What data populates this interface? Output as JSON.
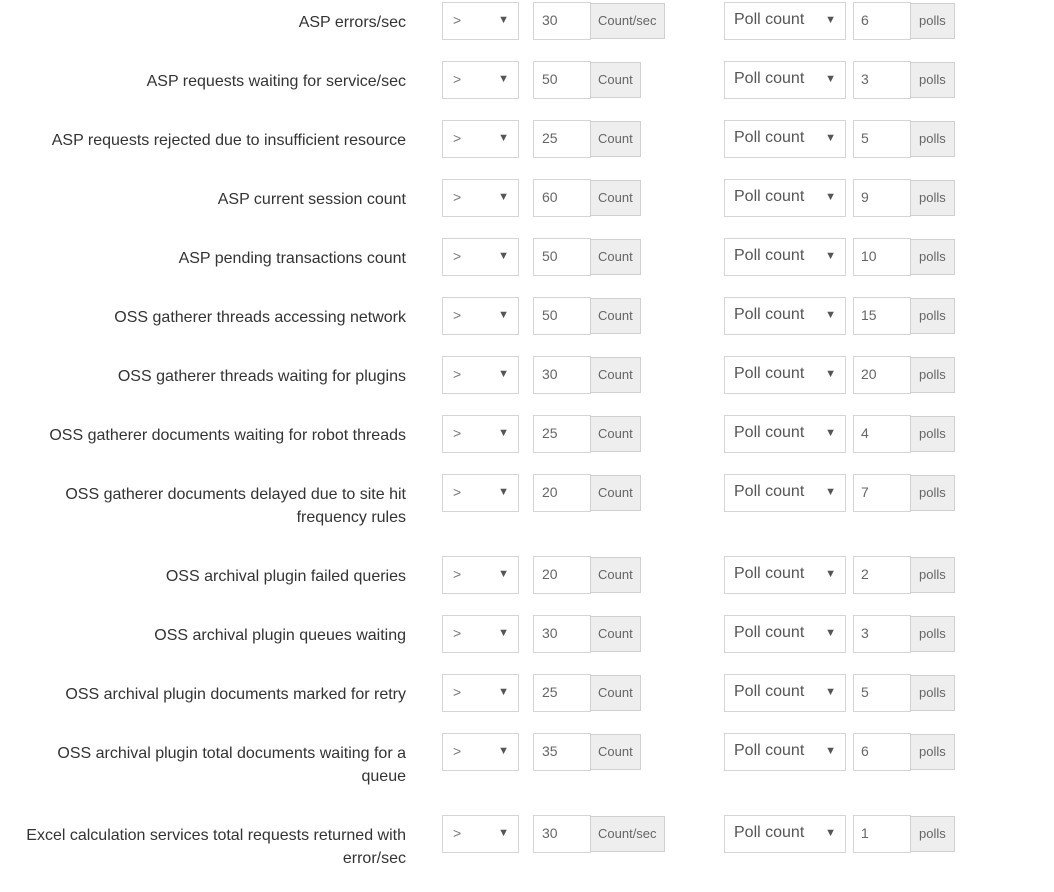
{
  "rows": [
    {
      "label": "ASP errors/sec",
      "operator": ">",
      "value": "30",
      "unit": "Count/sec",
      "poll_type": "Poll count",
      "polls": "6",
      "polls_unit": "polls"
    },
    {
      "label": "ASP requests waiting for service/sec",
      "operator": ">",
      "value": "50",
      "unit": "Count",
      "poll_type": "Poll count",
      "polls": "3",
      "polls_unit": "polls"
    },
    {
      "label": "ASP requests rejected due to insufficient resource",
      "operator": ">",
      "value": "25",
      "unit": "Count",
      "poll_type": "Poll count",
      "polls": "5",
      "polls_unit": "polls"
    },
    {
      "label": "ASP current session count",
      "operator": ">",
      "value": "60",
      "unit": "Count",
      "poll_type": "Poll count",
      "polls": "9",
      "polls_unit": "polls"
    },
    {
      "label": "ASP pending transactions count",
      "operator": ">",
      "value": "50",
      "unit": "Count",
      "poll_type": "Poll count",
      "polls": "10",
      "polls_unit": "polls"
    },
    {
      "label": "OSS gatherer threads accessing network",
      "operator": ">",
      "value": "50",
      "unit": "Count",
      "poll_type": "Poll count",
      "polls": "15",
      "polls_unit": "polls"
    },
    {
      "label": "OSS gatherer threads waiting for plugins",
      "operator": ">",
      "value": "30",
      "unit": "Count",
      "poll_type": "Poll count",
      "polls": "20",
      "polls_unit": "polls"
    },
    {
      "label": "OSS gatherer documents waiting for robot threads",
      "operator": ">",
      "value": "25",
      "unit": "Count",
      "poll_type": "Poll count",
      "polls": "4",
      "polls_unit": "polls"
    },
    {
      "label": "OSS gatherer documents delayed due to site hit frequency rules",
      "operator": ">",
      "value": "20",
      "unit": "Count",
      "poll_type": "Poll count",
      "polls": "7",
      "polls_unit": "polls"
    },
    {
      "label": "OSS archival plugin failed queries",
      "operator": ">",
      "value": "20",
      "unit": "Count",
      "poll_type": "Poll count",
      "polls": "2",
      "polls_unit": "polls"
    },
    {
      "label": "OSS archival plugin queues waiting",
      "operator": ">",
      "value": "30",
      "unit": "Count",
      "poll_type": "Poll count",
      "polls": "3",
      "polls_unit": "polls"
    },
    {
      "label": "OSS archival plugin documents marked for retry",
      "operator": ">",
      "value": "25",
      "unit": "Count",
      "poll_type": "Poll count",
      "polls": "5",
      "polls_unit": "polls"
    },
    {
      "label": "OSS archival plugin total documents waiting for a queue",
      "operator": ">",
      "value": "35",
      "unit": "Count",
      "poll_type": "Poll count",
      "polls": "6",
      "polls_unit": "polls"
    },
    {
      "label": "Excel calculation services total requests returned with error/sec",
      "operator": ">",
      "value": "30",
      "unit": "Count/sec",
      "poll_type": "Poll count",
      "polls": "1",
      "polls_unit": "polls"
    }
  ],
  "icons": {
    "caret": "▼"
  }
}
